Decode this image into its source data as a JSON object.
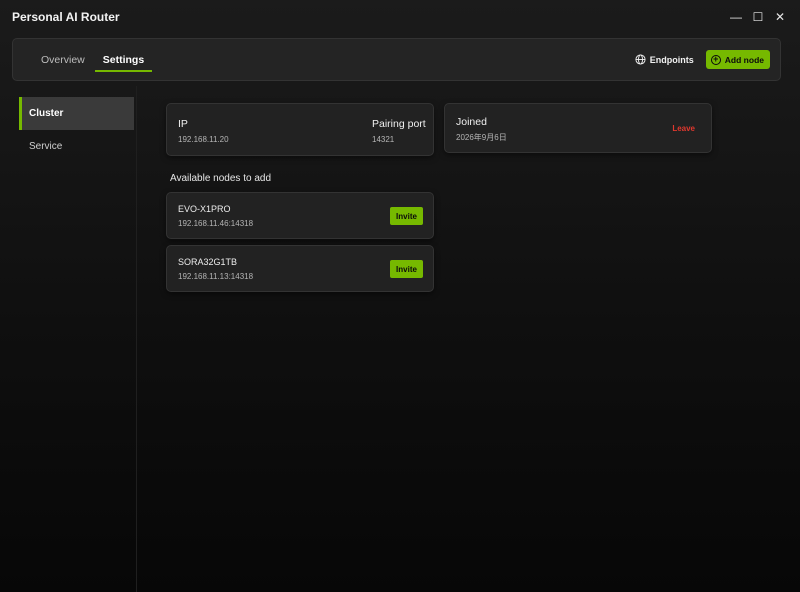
{
  "window": {
    "title": "Personal AI Router",
    "minimize_glyph": "—",
    "maximize_glyph": "☐",
    "close_glyph": "✕"
  },
  "topbar": {
    "tabs": [
      {
        "label": "Overview",
        "active": false
      },
      {
        "label": "Settings",
        "active": true
      }
    ],
    "endpoints_label": "Endpoints",
    "add_node_label": "Add node",
    "accent_color": "#76b900"
  },
  "sidebar": {
    "items": [
      {
        "label": "Cluster",
        "active": true
      },
      {
        "label": "Service",
        "active": false
      }
    ]
  },
  "cluster": {
    "ip_label": "IP",
    "ip_value": "192.168.11.20",
    "port_label": "Pairing port",
    "port_value": "14321",
    "joined_label": "Joined",
    "joined_date": "2026年9月6日",
    "leave_label": "Leave",
    "leave_color": "#e0382e"
  },
  "available": {
    "title": "Available nodes to add",
    "nodes": [
      {
        "name": "EVO-X1PRO",
        "address": "192.168.11.46:14318",
        "action": "Invite"
      },
      {
        "name": "SORA32G1TB",
        "address": "192.168.11.13:14318",
        "action": "Invite"
      }
    ]
  },
  "icons": {
    "globe": "globe-icon",
    "plus": "plus-circle-icon",
    "minimize": "minimize-icon",
    "maximize": "maximize-icon",
    "close": "close-icon"
  }
}
